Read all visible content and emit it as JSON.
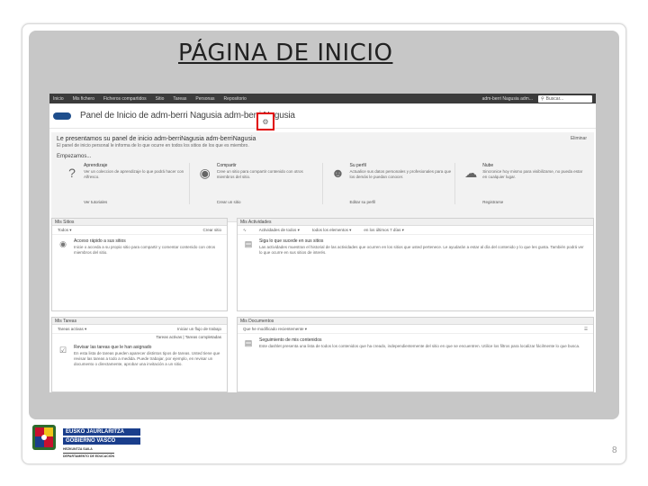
{
  "slide": {
    "title": "PÁGINA DE INICIO",
    "page_number": "8"
  },
  "topbar": {
    "nav": [
      "Inicio",
      "Mis fichero",
      "Ficheros compartidos",
      "Sitio",
      "Tareas",
      "Personas",
      "Repositorio"
    ],
    "user": "adm-berri Nagusia adm...",
    "search_placeholder": "Buscar..."
  },
  "header": {
    "panel_title": "Panel de Inicio de adm-berri Nagusia adm-berri Nagusia"
  },
  "welcome": {
    "heading": "Le presentamos su panel de inicio adm-berriNagusia adm-berriNagusia",
    "subtitle": "El panel de inicio personal le informa de lo que ocurre en todos los sitios de los que es miembro.",
    "close": "Eliminar",
    "start": "Empezamos...",
    "cards": [
      {
        "icon": "question-icon",
        "title": "Aprendizaje",
        "desc": "Ver un coleccion de aprendizaje lo que podrá hacer con Alfresco.",
        "link": "Ver tutoriales"
      },
      {
        "icon": "globe-icon",
        "title": "Compartir",
        "desc": "Cree un sitio para compartir contenido con otros miembros del sitio.",
        "link": "Crear un sitio"
      },
      {
        "icon": "person-icon",
        "title": "Su perfil",
        "desc": "Actualice sus datos personales y profesionales para que los demás le puedan conocer.",
        "link": "Editar su perfil"
      },
      {
        "icon": "cloud-icon",
        "title": "Nube",
        "desc": "Sincronice hoy mismo para visibilizarse, no pueda estar en cualquier lugar.",
        "link": "Registrarse"
      }
    ]
  },
  "widgets": {
    "sites": {
      "title": "Mis Sitios",
      "filter": "Todos",
      "action": "Crear sitio",
      "body_title": "Acceso rápido a sus sitios",
      "body_desc": "Inicie o acceda a su propio sitio para compartir y comentar contenido con otros miembros del sitio."
    },
    "activities": {
      "title": "Mis Actividades",
      "filter1": "Actividades de todos",
      "filter2": "todos los elementos",
      "filter3": "en los últimos 7 días",
      "body_title": "Siga lo que sucede en sus sitios",
      "body_desc": "Las actividades muestran el historial de las actividades que ocurren en los sitios que usted pertenece. Le ayudarán a estar al día del contenido y lo que les gusta. También podrá ver lo que ocurre en sus sitios de interés."
    },
    "tasks": {
      "title": "Mis Tareas",
      "filter": "Tareas activas",
      "action": "Iniciar un flujo de trabajo",
      "links": "Tareas activas | Tareas completadas",
      "body_title": "Revisar las tareas que le han asignado",
      "body_desc": "En esta lista de tareas pueden aparecer distintos tipos de tareas. Usted tiene que revisar las tareas a todo a medida. Puede trabajar, por ejemplo, en revisar un documento o directamente, aprobar una invitación a un sitio."
    },
    "documents": {
      "title": "Mis Documentos",
      "filter": "Que he modificado recientemente",
      "body_title": "Seguimiento de mis contenidos",
      "body_desc": "Este dashlet presenta una lista de todos los contenidos que ha creado, independientemente del sitio en que se encuentren. Utilice los filtros para localizar fácilmente lo que busca."
    }
  },
  "footer_logo": {
    "line1": "EUSKO JAURLARITZA",
    "line2": "GOBIERNO VASCO",
    "dept1": "HEZKUNTZA SAILA",
    "dept2": "DEPARTAMENTO DE EDUCACIÓN"
  },
  "colors": {
    "edit_highlight": "#e00000",
    "topbar": "#3b3b3b",
    "logo_blue": "#1a3e8c"
  }
}
